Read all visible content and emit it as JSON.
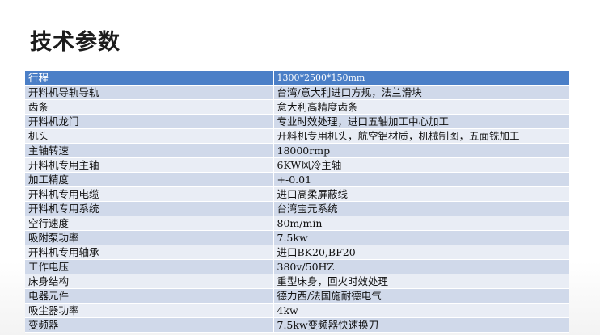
{
  "title": "技术参数",
  "colors": {
    "header_row": "#4b7fc7",
    "row_dark": "#d0d9ea",
    "row_light": "#e9edf5"
  },
  "specs": [
    {
      "name": "行程",
      "value": "1300*2500*150mm"
    },
    {
      "name": "开料机导轨导轨",
      "value": "台湾/意大利进口方规，法兰滑块"
    },
    {
      "name": "齿条",
      "value": "意大利高精度齿条"
    },
    {
      "name": "开料机龙门",
      "value": "专业时效处理，进口五轴加工中心加工"
    },
    {
      "name": "机头",
      "value": "开料机专用机头，航空铝材质，机械制图，五面铣加工"
    },
    {
      "name": "主轴转速",
      "value": "18000rmp"
    },
    {
      "name": "开料机专用主轴",
      "value": "6KW风冷主轴"
    },
    {
      "name": "加工精度",
      "value": "+-0.01"
    },
    {
      "name": "开料机专用电缆",
      "value": "进口高柔屏蔽线"
    },
    {
      "name": "开料机专用系统",
      "value": "台湾宝元系统"
    },
    {
      "name": "空行速度",
      "value": "80m/min"
    },
    {
      "name": "吸附泵功率",
      "value": "7.5kw"
    },
    {
      "name": "开料机专用轴承",
      "value": "进口BK20,BF20"
    },
    {
      "name": "工作电压",
      "value": "380v/50HZ"
    },
    {
      "name": "床身结构",
      "value": "重型床身，回火时效处理"
    },
    {
      "name": "电器元件",
      "value": "德力西/法国施耐德电气"
    },
    {
      "name": "吸尘器功率",
      "value": "4kw"
    },
    {
      "name": "变频器",
      "value": "7.5kw变频器快速换刀"
    }
  ]
}
